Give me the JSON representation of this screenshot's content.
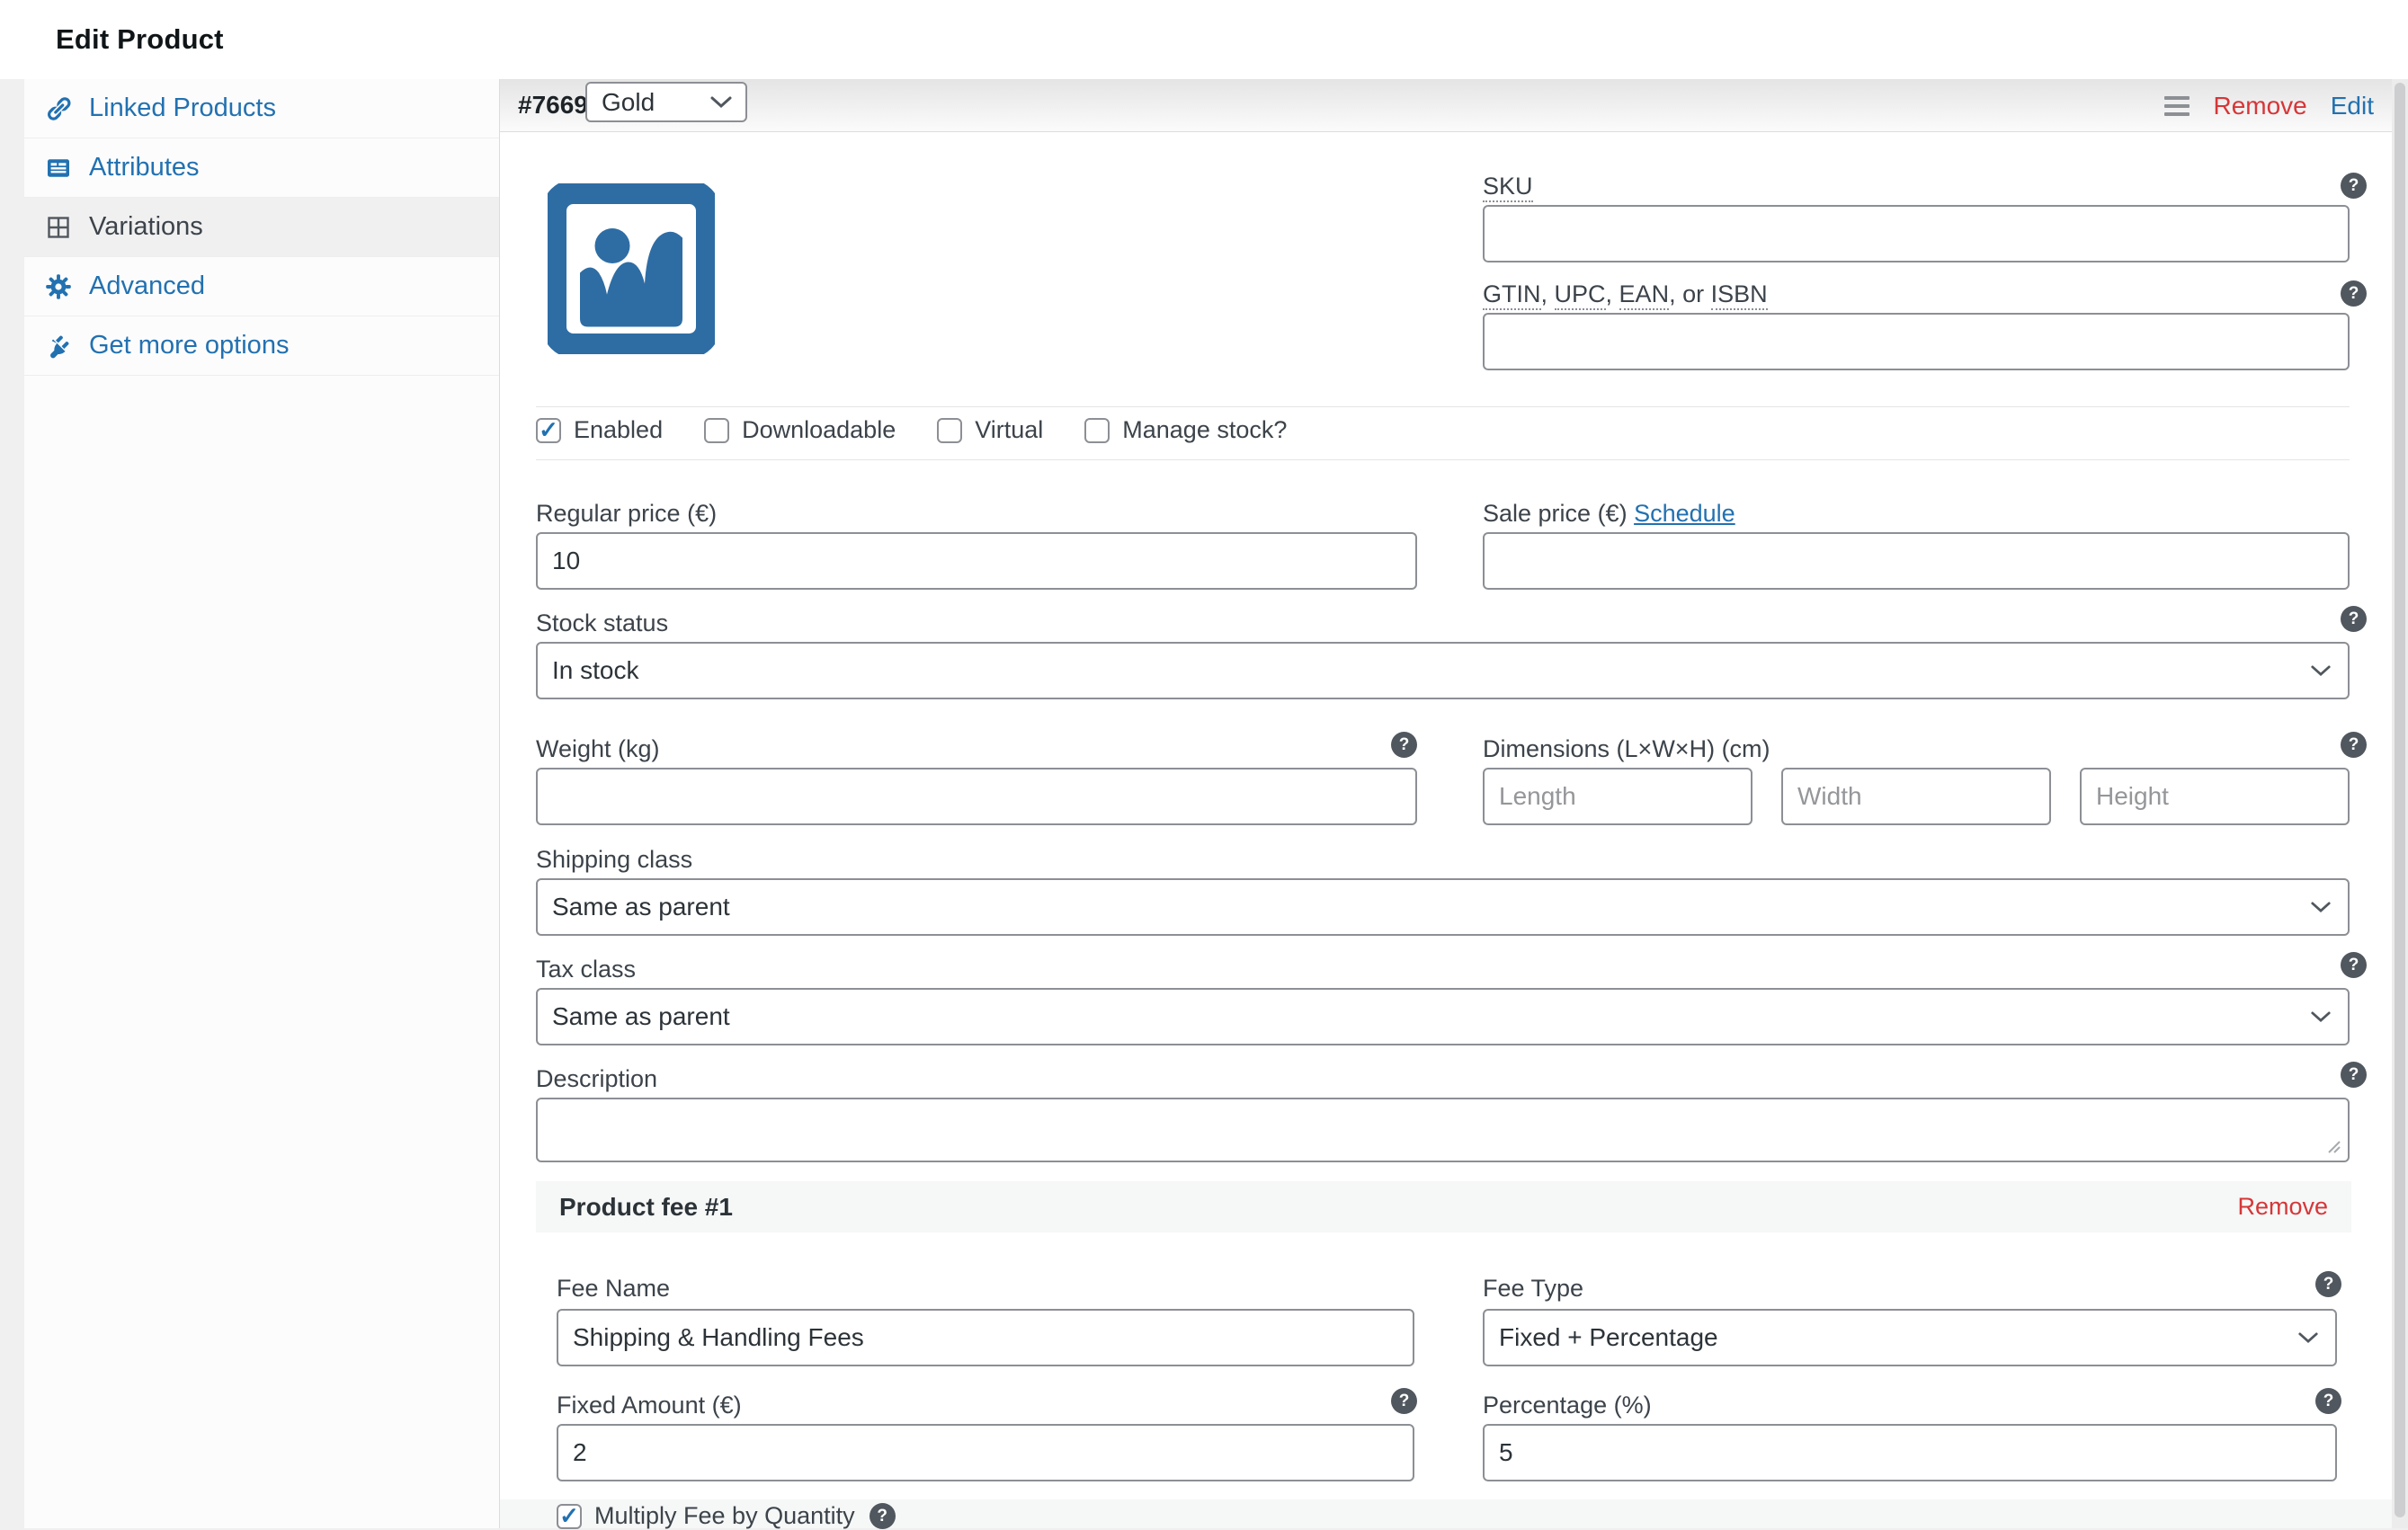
{
  "glyphs": {
    "check": "✓",
    "question": "?"
  },
  "colors": {
    "accent": "#2271b1",
    "danger": "#d63638",
    "label": "#3c434a",
    "placeholder_blue": "#2e6da4"
  },
  "topbar": {
    "title": "Edit Product"
  },
  "sidebar": {
    "items": [
      {
        "label": "Linked Products"
      },
      {
        "label": "Attributes"
      },
      {
        "label": "Variations"
      },
      {
        "label": "Advanced"
      },
      {
        "label": "Get more options"
      }
    ]
  },
  "variation": {
    "id": "#7669",
    "attribute_value": "Gold",
    "remove": "Remove",
    "edit": "Edit",
    "toggles": {
      "enabled": "Enabled",
      "downloadable": "Downloadable",
      "virtual": "Virtual",
      "manage_stock": "Manage stock?"
    },
    "sku": {
      "label": "SKU",
      "value": ""
    },
    "gtin": {
      "p1": "GTIN",
      "s1": ", ",
      "p2": "UPC",
      "s2": ", ",
      "p3": "EAN",
      "s3": " or ",
      "p4": "ISBN",
      "value": ""
    },
    "regular_price": {
      "label": "Regular price (€)",
      "value": "10"
    },
    "sale_price": {
      "label": "Sale price (€)",
      "schedule": "Schedule",
      "value": ""
    },
    "stock_status": {
      "label": "Stock status",
      "value": "In stock"
    },
    "weight": {
      "label": "Weight (kg)",
      "value": ""
    },
    "dimensions": {
      "label": "Dimensions (L×W×H) (cm)",
      "length": "Length",
      "width": "Width",
      "height": "Height"
    },
    "shipping_class": {
      "label": "Shipping class",
      "value": "Same as parent"
    },
    "tax_class": {
      "label": "Tax class",
      "value": "Same as parent"
    },
    "description": {
      "label": "Description",
      "value": ""
    }
  },
  "fee": {
    "title": "Product fee #1",
    "remove": "Remove",
    "name": {
      "label": "Fee Name",
      "value": "Shipping & Handling Fees"
    },
    "type": {
      "label": "Fee Type",
      "value": "Fixed + Percentage"
    },
    "fixed": {
      "label": "Fixed Amount (€)",
      "value": "2"
    },
    "percentage": {
      "label": "Percentage (%)",
      "value": "5"
    },
    "multiply": {
      "label": "Multiply Fee by Quantity"
    }
  }
}
